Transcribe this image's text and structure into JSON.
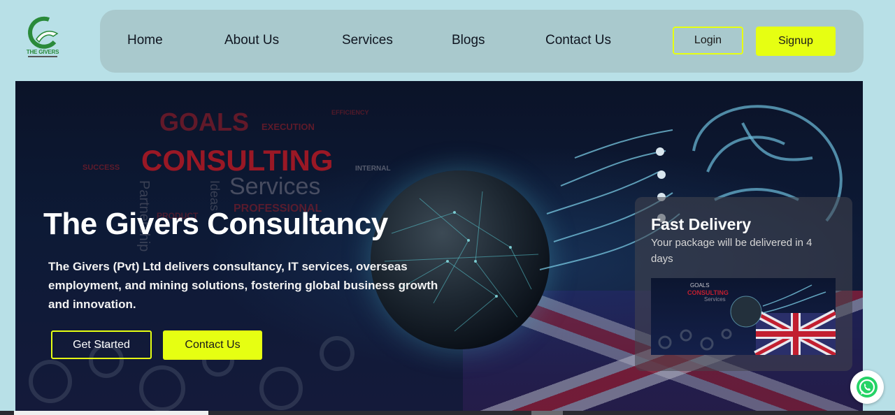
{
  "logo": {
    "text": "THE GIVERS",
    "brand_color": "#2a8a3a"
  },
  "nav": {
    "links": [
      "Home",
      "About Us",
      "Services",
      "Blogs",
      "Contact Us"
    ],
    "login_label": "Login",
    "signup_label": "Signup",
    "accent": "#e6ff12"
  },
  "hero": {
    "title": "The Givers Consultancy",
    "description": "The Givers (Pvt) Ltd delivers consultancy, IT services, overseas employment, and mining solutions, fostering global business growth and innovation.",
    "get_started_label": "Get Started",
    "contact_label": "Contact Us",
    "background_words": [
      "GOALS",
      "EXECUTION",
      "EFFICIENCY",
      "CONSULTING",
      "SUCCESS",
      "INTERNAL",
      "Services",
      "Partnership",
      "Ideas",
      "PROFESSIONAL",
      "PRODUCT"
    ]
  },
  "card": {
    "title": "Fast Delivery",
    "text": "Your package will be delivered in 4 days",
    "image_words": [
      "GOALS",
      "CONSULTING",
      "Services"
    ]
  },
  "whatsapp": {
    "icon": "whatsapp-icon",
    "color": "#25d366"
  }
}
